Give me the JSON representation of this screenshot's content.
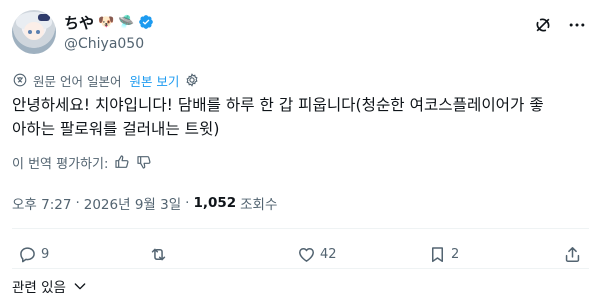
{
  "header": {
    "display_name": "ちや",
    "name_emojis": [
      "🐶",
      "🛸"
    ],
    "handle": "@Chiya050",
    "verified_color": "#1d9bf0"
  },
  "translation": {
    "note": "원문 언어 일본어",
    "show_original": "원본 보기"
  },
  "tweet": {
    "text_line1": "안녕하세요! 치야입니다! 담배를 하루 한 갑 피웁니다(청순한 여코스플레이어가 좋",
    "text_line2": "아하는 팔로워를 걸러내는 트윗)"
  },
  "rate_translation": {
    "label": "이 번역 평가하기:"
  },
  "meta": {
    "time": "오후 7:27",
    "date": "2026년 9월 3일",
    "views_count": "1,052",
    "views_label": "조회수"
  },
  "actions": {
    "reply_count": "9",
    "repost_count": "",
    "like_count": "42",
    "bookmark_count": "2"
  },
  "related": {
    "label": "관련 있음"
  },
  "colors": {
    "accent": "#1d9bf0",
    "secondary_text": "#536471",
    "primary_text": "#0f1419"
  }
}
